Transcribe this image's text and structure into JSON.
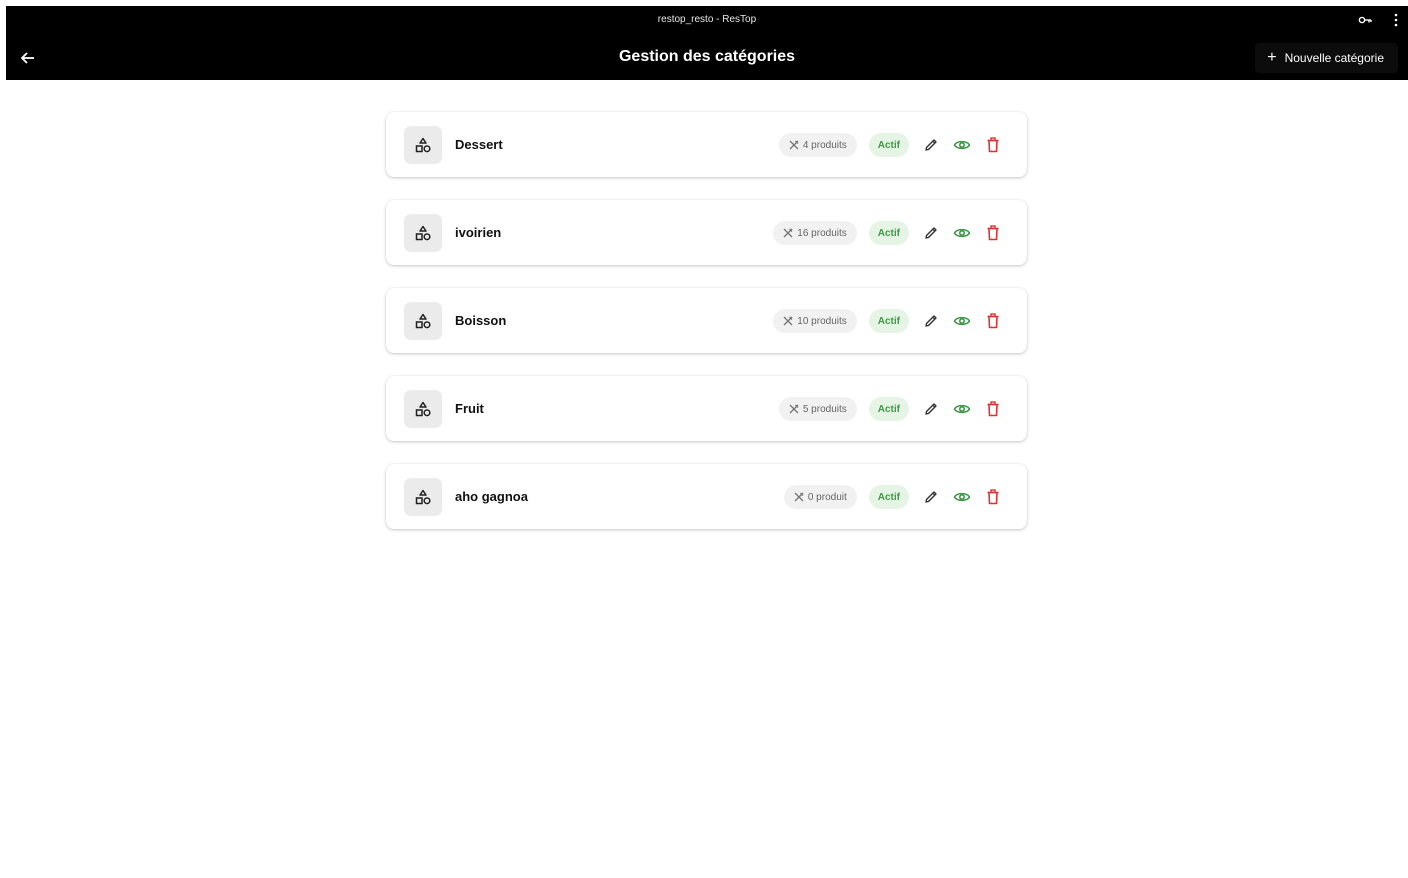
{
  "window": {
    "title": "restop_resto - ResTop"
  },
  "appbar": {
    "title": "Gestion des catégories",
    "new_button_label": "Nouvelle catégorie"
  },
  "colors": {
    "appbar_bg": "#000000",
    "status_green": "#3c9a42",
    "delete_red": "#d93434",
    "view_green": "#3c9a42"
  },
  "categories": [
    {
      "name": "Dessert",
      "count_label": "4 produits",
      "status": "Actif"
    },
    {
      "name": "ivoirien",
      "count_label": "16 produits",
      "status": "Actif"
    },
    {
      "name": "Boisson",
      "count_label": "10 produits",
      "status": "Actif"
    },
    {
      "name": "Fruit",
      "count_label": "5 produits",
      "status": "Actif"
    },
    {
      "name": "aho gagnoa",
      "count_label": "0 produit",
      "status": "Actif"
    }
  ]
}
